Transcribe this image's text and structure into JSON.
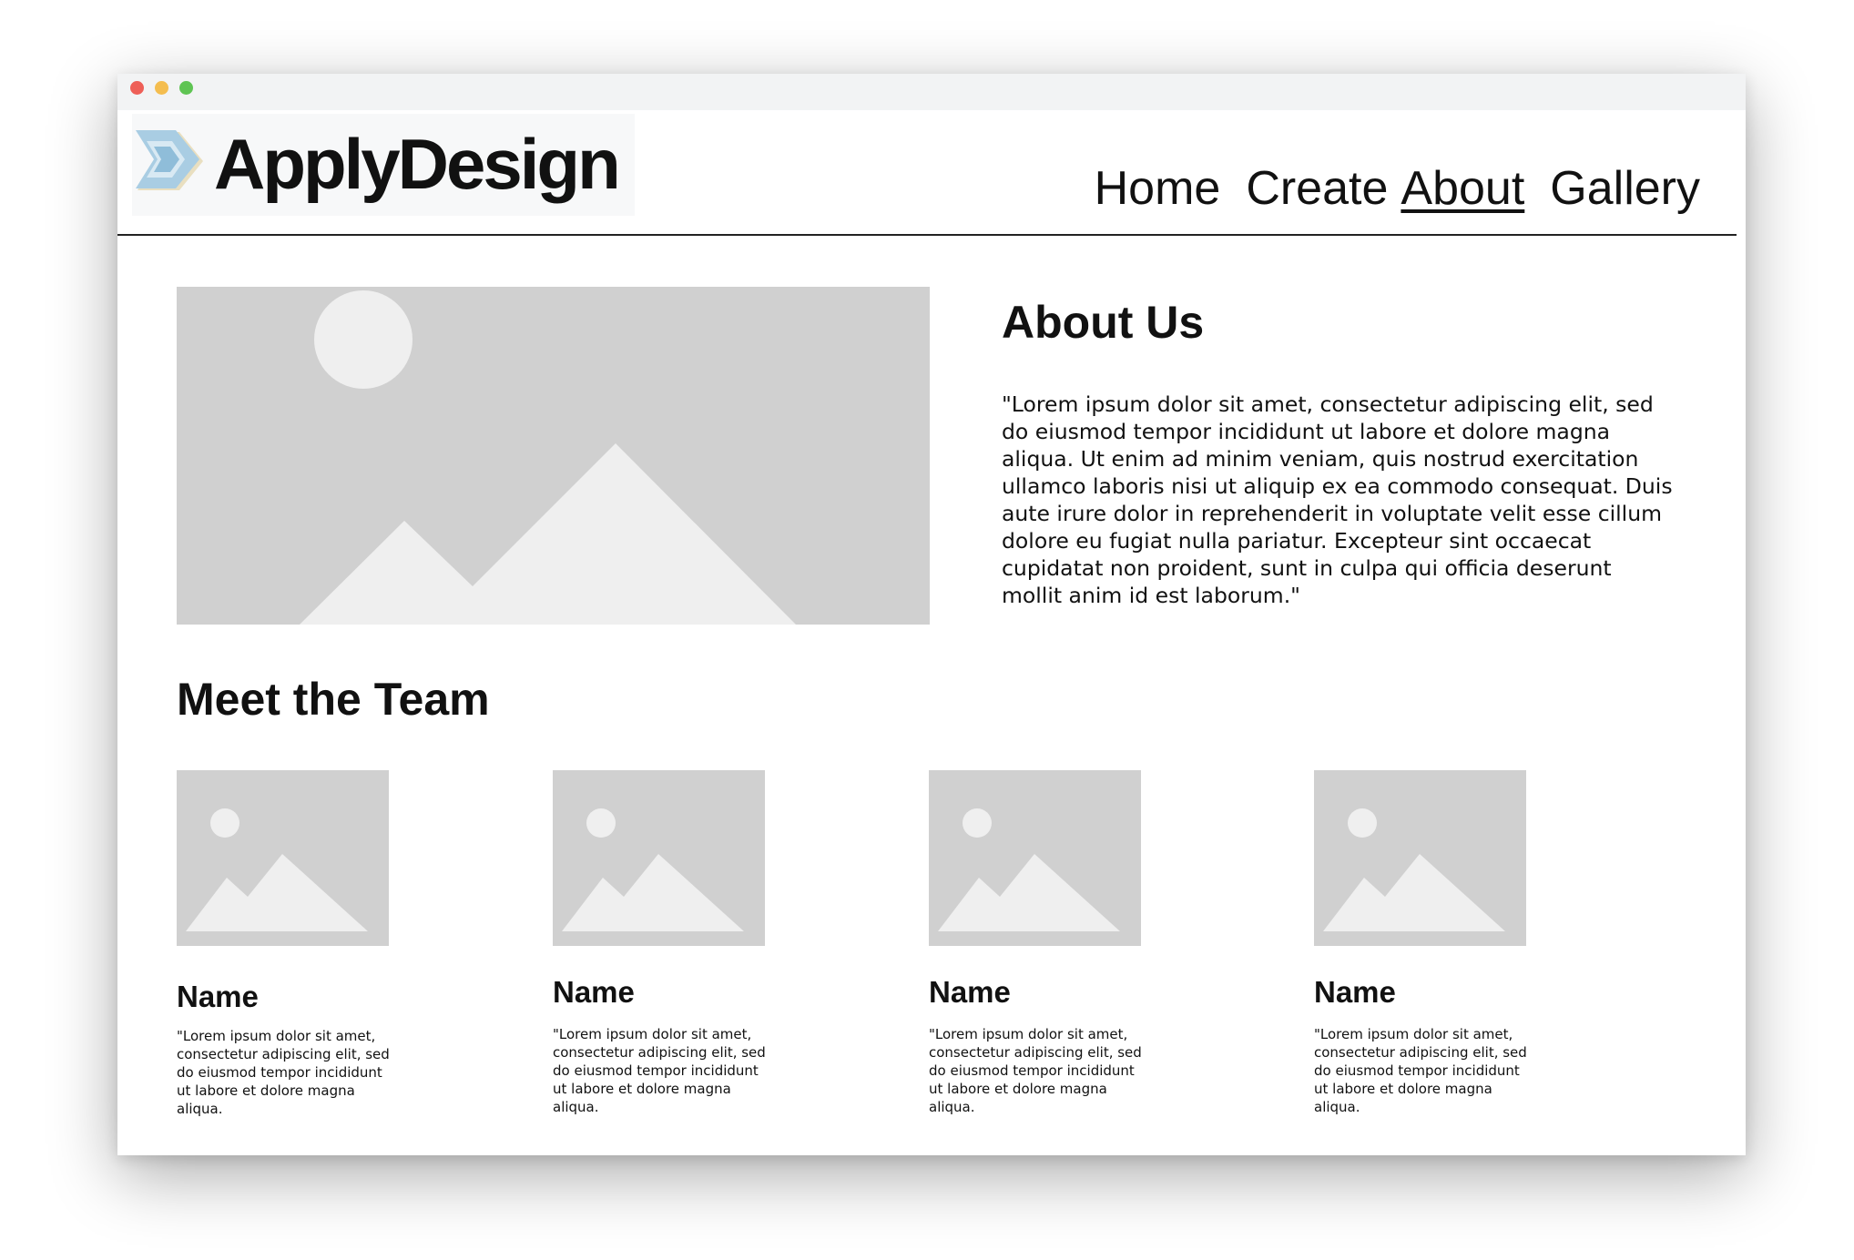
{
  "window": {
    "controls": [
      "close",
      "minimize",
      "zoom"
    ],
    "colors": {
      "close": "#ee5f57",
      "minimize": "#f4bd4f",
      "zoom": "#5fc453"
    }
  },
  "header": {
    "logo_text": "ApplyDesign",
    "logo_icon": "chevron-logo-icon",
    "nav": [
      {
        "label": "Home",
        "active": false
      },
      {
        "label": "Create",
        "active": false
      },
      {
        "label": "About",
        "active": true
      },
      {
        "label": "Gallery",
        "active": false
      }
    ]
  },
  "about": {
    "image_icon": "image-placeholder-icon",
    "heading": "About Us",
    "body": "\"Lorem ipsum dolor sit amet, consectetur adipiscing elit, sed do eiusmod tempor incididunt ut labore et dolore magna aliqua. Ut enim ad minim veniam, quis nostrud exercitation ullamco laboris nisi ut aliquip ex ea commodo consequat. Duis aute irure dolor in reprehenderit in voluptate velit esse cillum dolore eu fugiat nulla pariatur. Excepteur sint occaecat cupidatat non proident, sunt in culpa qui officia deserunt mollit anim id est laborum.\""
  },
  "team": {
    "heading": "Meet the Team",
    "members": [
      {
        "name": "Name",
        "bio": "\"Lorem ipsum dolor sit amet, consectetur adipiscing elit, sed do eiusmod tempor incididunt ut labore et dolore magna aliqua."
      },
      {
        "name": "Name",
        "bio": "\"Lorem ipsum dolor sit amet, consectetur adipiscing elit, sed do eiusmod tempor incididunt ut labore et dolore magna aliqua."
      },
      {
        "name": "Name",
        "bio": "\"Lorem ipsum dolor sit amet, consectetur adipiscing elit, sed do eiusmod tempor incididunt ut labore et dolore magna aliqua."
      },
      {
        "name": "Name",
        "bio": "\"Lorem ipsum dolor sit amet, consectetur adipiscing elit, sed do eiusmod tempor incididunt ut labore et dolore magna aliqua."
      }
    ]
  },
  "colors": {
    "placeholder_bg": "#d0d0d0",
    "placeholder_fg": "#efefef",
    "text": "#111111",
    "logo_blue": "#a9cde3",
    "logo_cream": "#f0e6c8"
  }
}
